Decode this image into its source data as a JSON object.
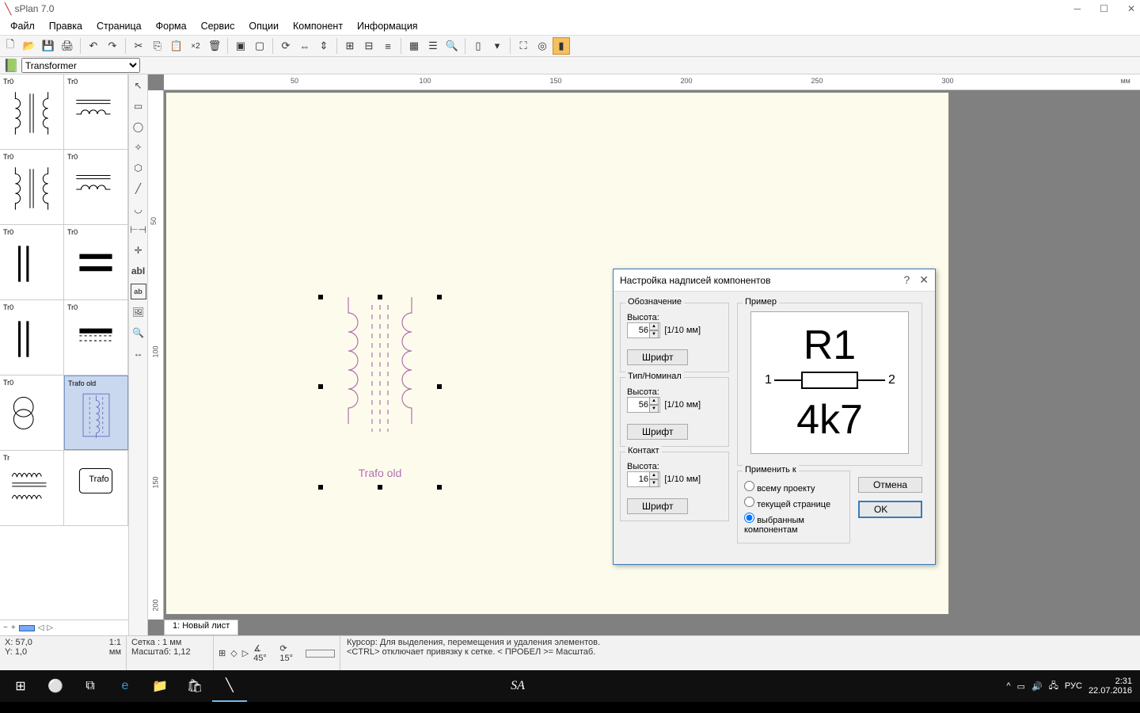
{
  "window": {
    "title": "sPlan 7.0"
  },
  "menu": [
    "Файл",
    "Правка",
    "Страница",
    "Форма",
    "Сервис",
    "Опции",
    "Компонент",
    "Информация"
  ],
  "category_selected": "Transformer",
  "ruler_unit": "мм",
  "ruler_top": [
    "50",
    "100",
    "150",
    "200",
    "250",
    "300"
  ],
  "ruler_left": [
    "50",
    "100",
    "150",
    "200"
  ],
  "canvas": {
    "selected_label": "Trafo old"
  },
  "tab": "1: Новый лист",
  "status": {
    "x": "X: 57,0",
    "y": "Y: 1,0",
    "ratio": "1:1",
    "units": "мм",
    "setka": "Сетка  : 1 мм",
    "masshtab": "Масштаб:  1,12",
    "angle1": "45°",
    "angle2": "15°",
    "cursor_line1": "Курсор: Для выделения, перемещения и удаления элементов.",
    "cursor_line2": "<CTRL> отключает привязку к сетке. < ПРОБЕЛ >= Масштаб."
  },
  "components": [
    {
      "l": "Tr0",
      "r": "Tr0"
    },
    {
      "l": "Tr0",
      "r": "Tr0"
    },
    {
      "l": "Tr0",
      "r": "Tr0"
    },
    {
      "l": "Tr0",
      "r": "Tr0"
    },
    {
      "l": "Tr0",
      "r": "Trafo old",
      "selected": "r"
    },
    {
      "l": "Tr",
      "r": "Trafo"
    }
  ],
  "dialog": {
    "title": "Настройка надписей компонентов",
    "groups": {
      "designation": {
        "title": "Обозначение",
        "height_label": "Высота:",
        "height": "56",
        "unit": "[1/10 мм]",
        "font_btn": "Шрифт"
      },
      "type": {
        "title": "Тип/Номинал",
        "height_label": "Высота:",
        "height": "56",
        "unit": "[1/10 мм]",
        "font_btn": "Шрифт"
      },
      "contact": {
        "title": "Контакт",
        "height_label": "Высота:",
        "height": "16",
        "unit": "[1/10 мм]",
        "font_btn": "Шрифт"
      },
      "preview": {
        "title": "Пример",
        "top": "R1",
        "bottom": "4k7",
        "pin1": "1",
        "pin2": "2"
      },
      "applyto": {
        "title": "Применить к",
        "options": [
          "всему проекту",
          "текущей странице",
          "выбранным компонентам"
        ],
        "selected": 2
      }
    },
    "ok": "OK",
    "cancel": "Отмена"
  },
  "taskbar": {
    "lang": "РУС",
    "time": "2:31",
    "date": "22.07.2016"
  }
}
